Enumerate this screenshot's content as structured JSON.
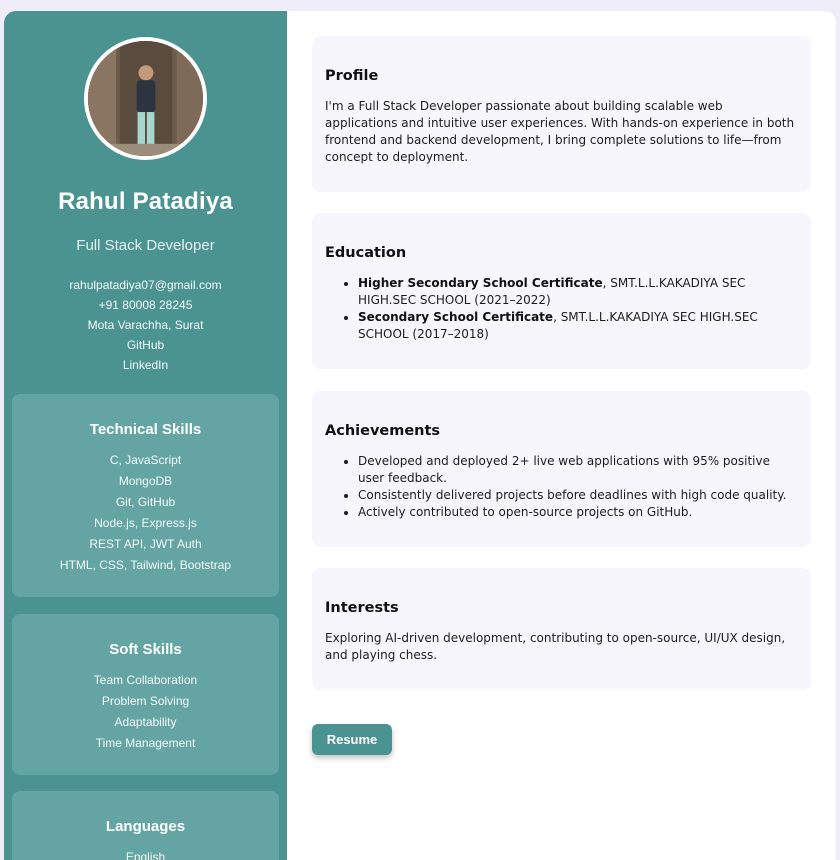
{
  "sidebar": {
    "name": "Rahul Patadiya",
    "role": "Full Stack Developer",
    "contact": {
      "email": "rahulpatadiya07@gmail.com",
      "phone": "+91 80008 28245",
      "location": "Mota Varachha, Surat",
      "github_label": "GitHub",
      "linkedin_label": "LinkedIn"
    },
    "technical_skills": {
      "title": "Technical Skills",
      "items": [
        "C, JavaScript",
        "MongoDB",
        "Git, GitHub",
        "Node.js, Express.js",
        "REST API, JWT Auth",
        "HTML, CSS, Tailwind, Bootstrap"
      ]
    },
    "soft_skills": {
      "title": "Soft Skills",
      "items": [
        "Team Collaboration",
        "Problem Solving",
        "Adaptability",
        "Time Management"
      ]
    },
    "languages": {
      "title": "Languages",
      "items": [
        "English"
      ]
    }
  },
  "main": {
    "profile": {
      "title": "Profile",
      "text": "I'm a Full Stack Developer passionate about building scalable web applications and intuitive user experiences. With hands-on experience in both frontend and backend development, I bring complete solutions to life—from concept to deployment."
    },
    "education": {
      "title": "Education",
      "items": [
        {
          "degree": "Higher Secondary School Certificate",
          "detail": ", SMT.L.L.KAKADIYA SEC HIGH.SEC SCHOOL (2021–2022)"
        },
        {
          "degree": "Secondary School Certificate",
          "detail": ", SMT.L.L.KAKADIYA SEC HIGH.SEC SCHOOL (2017–2018)"
        }
      ]
    },
    "achievements": {
      "title": "Achievements",
      "items": [
        "Developed and deployed 2+ live web applications with 95% positive user feedback.",
        "Consistently delivered projects before deadlines with high code quality.",
        "Actively contributed to open-source projects on GitHub."
      ]
    },
    "interests": {
      "title": "Interests",
      "text": "Exploring AI-driven development, contributing to open-source, UI/UX design, and playing chess."
    },
    "resume_button": "Resume"
  },
  "colors": {
    "sidebar_bg": "#4a9391",
    "panel_bg": "#64a5a3",
    "section_bg": "#f7f6fd",
    "page_bg": "#efedf8"
  }
}
